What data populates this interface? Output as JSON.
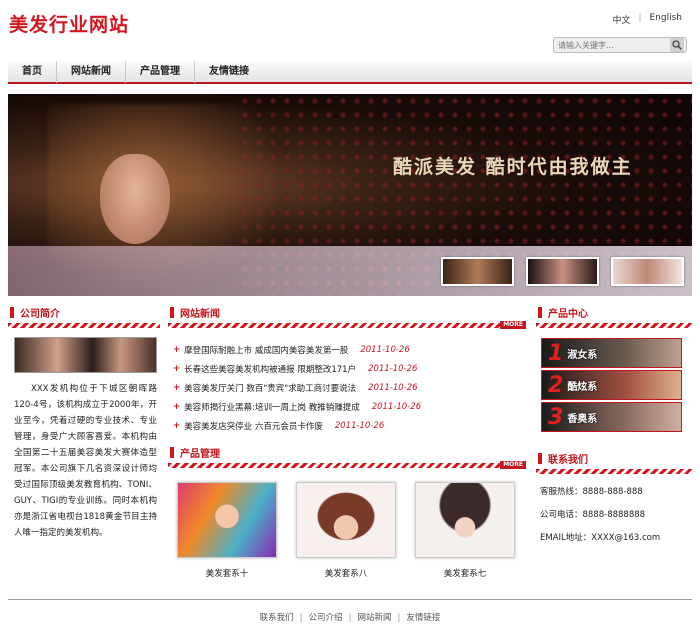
{
  "header": {
    "logo": "美发行业网站",
    "lang_cn": "中文",
    "lang_sep": "|",
    "lang_en": "English",
    "search_placeholder": "请输入关键字..."
  },
  "nav": [
    "首页",
    "网站新闻",
    "产品管理",
    "友情链接"
  ],
  "banner": {
    "slogan": "酷派美发  酷时代由我做主"
  },
  "about": {
    "title": "公司简介",
    "text": "XXX发机构位于下城区朝晖路120-4号，该机构成立于2000年，开业至今，凭着过硬的专业技术、专业管理，身受广大顾客喜爱。本机构由全国第二十五届美容美发大赛体造型冠军。本公司旗下几名资深设计师均受过国际顶级美发教育机构、TONI、GUY、TIGI的专业训练。同时本机构亦是浙江省电视台1818黄金节目主持人唯一指定的美发机构。"
  },
  "news": {
    "title": "网站新闻",
    "more": "MORE",
    "items": [
      {
        "title": "摩登国际耐融上市 威成国内美容美发第一股",
        "date": "2011-10-26"
      },
      {
        "title": "长春这些美容美发机构被通报 限期整改171户",
        "date": "2011-10-26"
      },
      {
        "title": "美容美发厅关门 数百\"贵宾\"求助工商讨要说法",
        "date": "2011-10-26"
      },
      {
        "title": "美容师揭行业黑幕:培训一周上岗 教推销赚提成",
        "date": "2011-10-26"
      },
      {
        "title": "美容美发店突停业 六百元会员卡作废",
        "date": "2011-10-26"
      }
    ]
  },
  "products": {
    "title": "产品管理",
    "more": "MORE",
    "items": [
      "美发套系十",
      "美发套系八",
      "美发套系七"
    ]
  },
  "product_center": {
    "title": "产品中心",
    "items": [
      {
        "num": "1",
        "name": "淑女系"
      },
      {
        "num": "2",
        "name": "酷炫系"
      },
      {
        "num": "3",
        "name": "香奥系"
      }
    ]
  },
  "contact": {
    "title": "联系我们",
    "hotline": "客服热线：8888-888-888",
    "phone": "公司电话：8888-8888888",
    "email": "EMAIL地址：XXXX@163.com"
  },
  "footer": [
    "联系我们",
    "公司介绍",
    "网站新闻",
    "友情链接"
  ],
  "footer_sep": "|",
  "colors": {
    "accent": "#c3161d",
    "brand": "#d3161d"
  }
}
